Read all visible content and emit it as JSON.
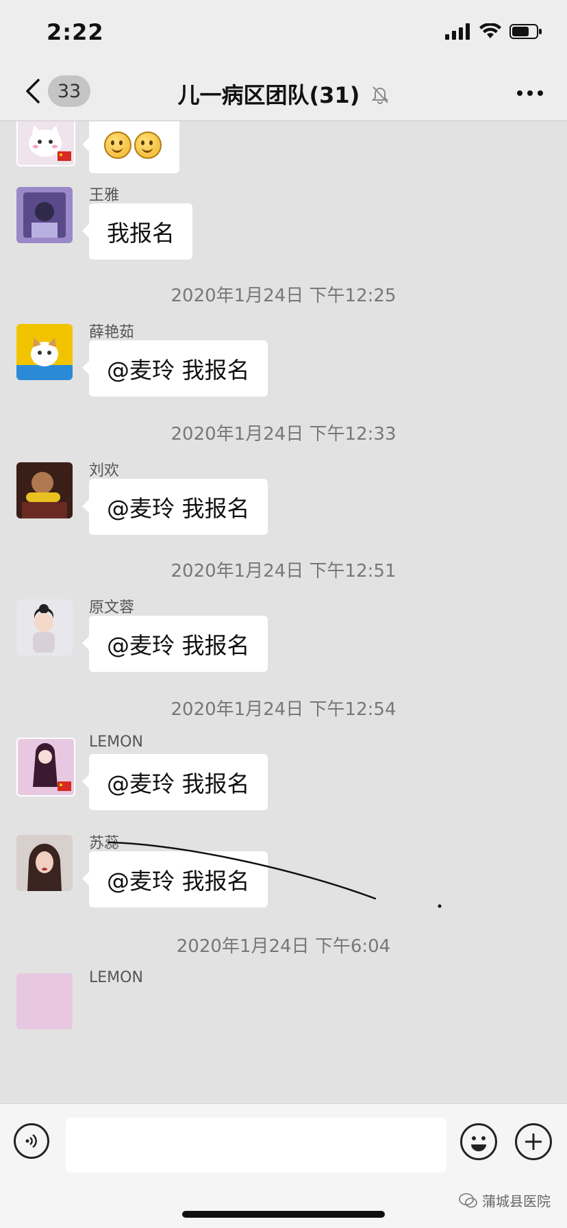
{
  "status_bar": {
    "time": "2:22"
  },
  "header": {
    "unread_count": "33",
    "title": "儿一病区团队(31)"
  },
  "messages": [
    {
      "sender": "",
      "text": "",
      "emoji": "smiling-face-emoji x2"
    },
    {
      "sender": "王雅",
      "text": "我报名"
    },
    {
      "sender": "薛艳茹",
      "text": "@麦玲 我报名"
    },
    {
      "sender": "刘欢",
      "text": "@麦玲 我报名"
    },
    {
      "sender": "原文蓉",
      "text": "@麦玲 我报名"
    },
    {
      "sender": "LEMON",
      "text": "@麦玲 我报名"
    },
    {
      "sender": "苏蕊",
      "text": "@麦玲 我报名"
    },
    {
      "sender": "LEMON",
      "text": ""
    }
  ],
  "timestamps": [
    "2020年1月24日 下午12:25",
    "2020年1月24日 下午12:33",
    "2020年1月24日 下午12:51",
    "2020年1月24日 下午12:54",
    "2020年1月24日 下午6:04"
  ],
  "input": {
    "value": "",
    "placeholder": ""
  },
  "watermark": "蒲城县医院",
  "colors": {
    "chat_bg": "#e2e2e2",
    "bubble": "#ffffff",
    "bar_bg": "#ededed"
  }
}
